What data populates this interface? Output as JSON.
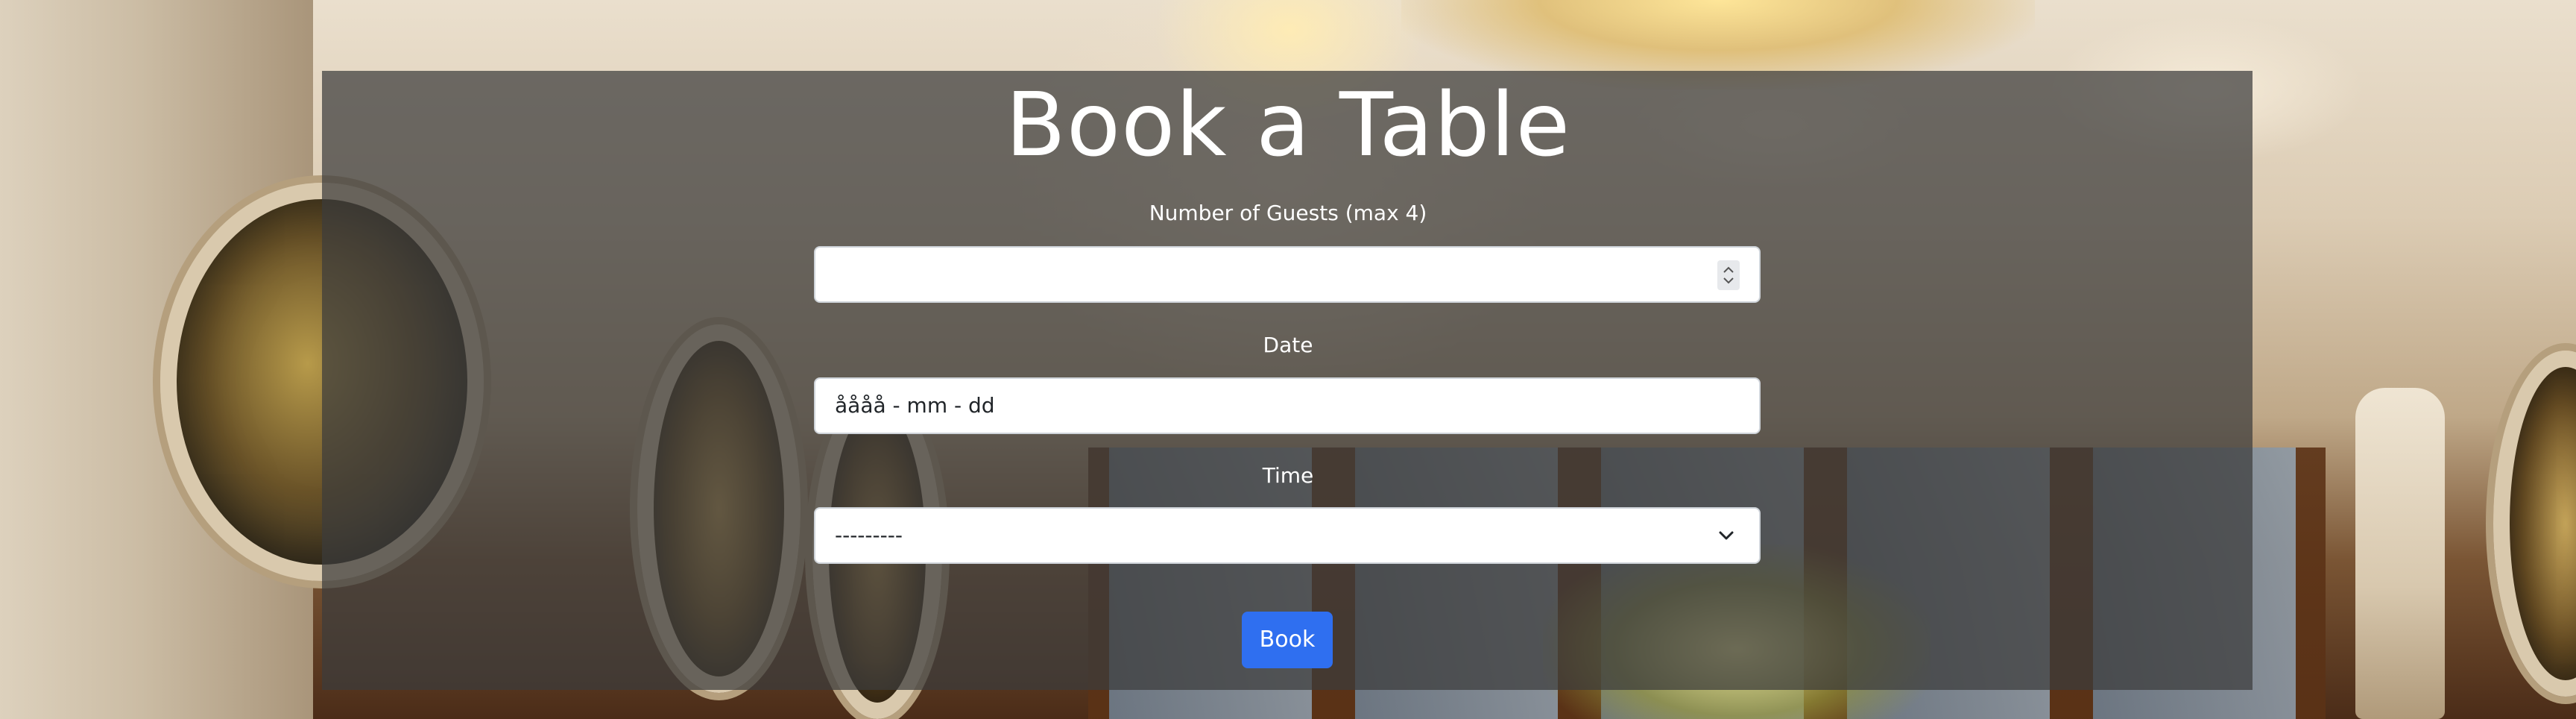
{
  "page": {
    "title": "Book a Table"
  },
  "form": {
    "guests": {
      "label": "Number of Guests (max 4)",
      "value": "",
      "icon": "spinner-icon"
    },
    "date": {
      "label": "Date",
      "display_value": "åååå - mm - dd"
    },
    "time": {
      "label": "Time",
      "selected": "---------",
      "icon": "chevron-down-icon"
    },
    "submit": {
      "label": "Book",
      "color": "#2f6ff0"
    }
  },
  "theme": {
    "panel_color": "#3c3c3c",
    "text_color": "#ffffff"
  }
}
